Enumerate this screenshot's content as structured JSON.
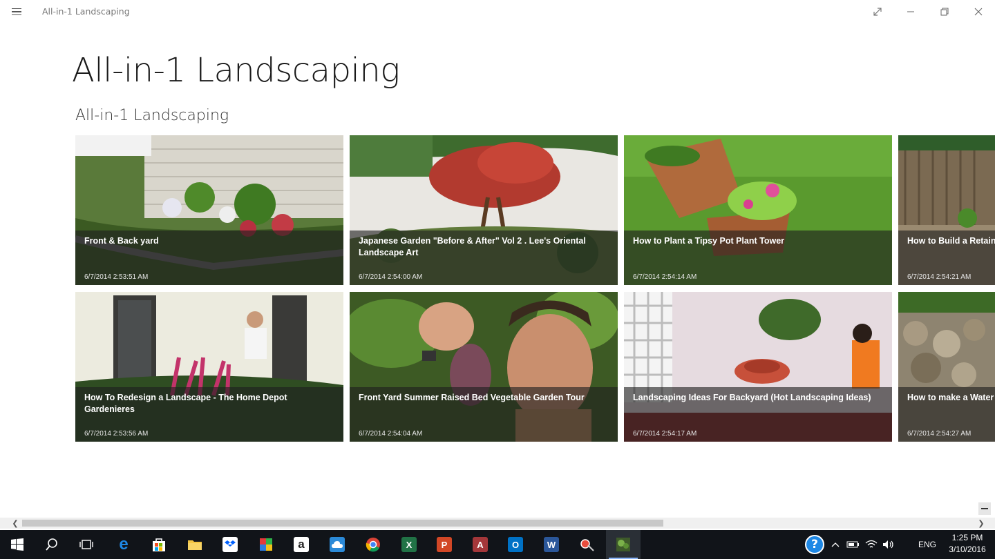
{
  "window": {
    "title": "All-in-1 Landscaping"
  },
  "page": {
    "title": "All-in-1 Landscaping",
    "section_title": "All-in-1 Landscaping"
  },
  "videos": [
    {
      "title": "Front & Back yard",
      "date": "6/7/2014 2:53:51 AM"
    },
    {
      "title": "Japanese Garden \"Before & After\" Vol 2 . Lee's Oriental Landscape Art",
      "date": "6/7/2014 2:54:00 AM"
    },
    {
      "title": "How to Plant a Tipsy Pot Plant Tower",
      "date": "6/7/2014 2:54:14 AM"
    },
    {
      "title": "How to Build a Retain",
      "date": "6/7/2014 2:54:21 AM"
    },
    {
      "title": "How To Redesign a Landscape - The Home Depot Gardenieres",
      "date": "6/7/2014 2:53:56 AM"
    },
    {
      "title": "Front Yard Summer Raised Bed Vegetable Garden Tour",
      "date": "6/7/2014 2:54:04 AM"
    },
    {
      "title": "Landscaping Ideas For Backyard (Hot Landscaping Ideas)",
      "date": "6/7/2014 2:54:17 AM"
    },
    {
      "title": "How to make a Water",
      "date": "6/7/2014 2:54:27 AM"
    }
  ],
  "taskbar": {
    "apps": [
      {
        "icon": "start-icon"
      },
      {
        "icon": "search-icon"
      },
      {
        "icon": "task-view-icon"
      },
      {
        "icon": "edge-icon",
        "label": "e"
      },
      {
        "icon": "store-icon"
      },
      {
        "icon": "file-explorer-icon"
      },
      {
        "icon": "dropbox-icon"
      },
      {
        "icon": "paint-icon"
      },
      {
        "icon": "amazon-icon",
        "label": "a"
      },
      {
        "icon": "onedrive-icon"
      },
      {
        "icon": "chrome-icon"
      },
      {
        "icon": "excel-icon",
        "label": "X"
      },
      {
        "icon": "powerpoint-icon",
        "label": "P"
      },
      {
        "icon": "access-icon",
        "label": "A"
      },
      {
        "icon": "outlook-icon",
        "label": "O"
      },
      {
        "icon": "word-icon",
        "label": "W"
      },
      {
        "icon": "snipping-icon"
      },
      {
        "icon": "landscaping-app-icon"
      }
    ],
    "tray": {
      "help_label": "?",
      "language": "ENG"
    },
    "clock": {
      "time": "1:25 PM",
      "date": "3/10/2016"
    }
  }
}
